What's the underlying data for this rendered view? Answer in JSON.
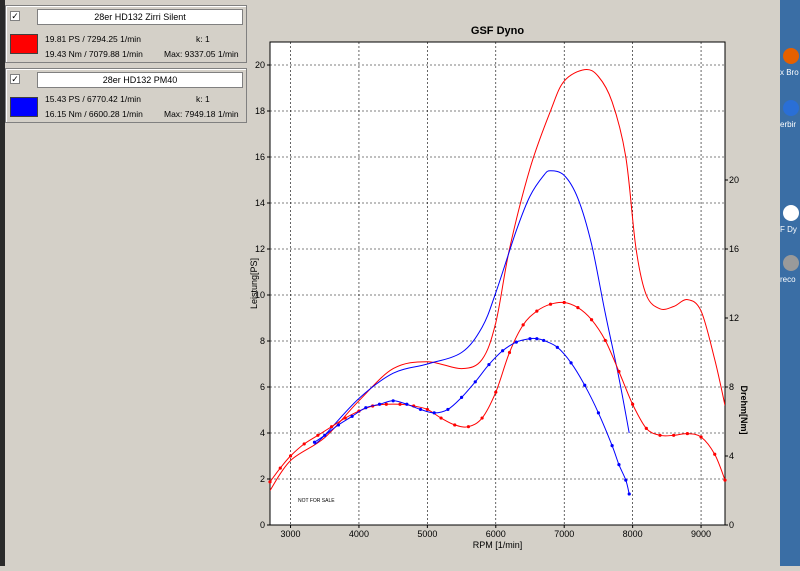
{
  "legend": [
    {
      "checked": "✓",
      "name": "28er HD132 Zirri Silent",
      "color": "#ff0000",
      "line1": "19.81 PS / 7294.25 1/min",
      "k": "k: 1",
      "line2": "19.43 Nm / 7079.88 1/min",
      "max": "Max: 9337.05 1/min"
    },
    {
      "checked": "✓",
      "name": "28er HD132 PM40",
      "color": "#0000ff",
      "line1": "15.43 PS / 6770.42 1/min",
      "k": "k: 1",
      "line2": "16.15 Nm / 6600.28 1/min",
      "max": "Max: 7949.18 1/min"
    }
  ],
  "desktop_icons": [
    {
      "name": "firefox-icon",
      "label": "x Bro",
      "color": "#e66000"
    },
    {
      "name": "thunderbird-icon",
      "label": "erbir",
      "color": "#2a6fd6"
    },
    {
      "name": "dyno-app-icon",
      "label": "F Dy",
      "color": "#ffffff"
    },
    {
      "name": "speaker-icon",
      "label": "reco",
      "color": "#9a9a9a"
    }
  ],
  "chart_data": {
    "type": "line",
    "title": "GSF Dyno",
    "xlabel": "RPM [1/min]",
    "ylabel": "Leistung[PS]",
    "y2label": "Drehm[Nm]",
    "watermark": "NOT FOR SALE",
    "xlim": [
      2700,
      9350
    ],
    "ylim": [
      0,
      21
    ],
    "y2lim": [
      0,
      28
    ],
    "xticks": [
      3000,
      4000,
      5000,
      6000,
      7000,
      8000,
      9000
    ],
    "yticks": [
      0,
      2,
      4,
      6,
      8,
      10,
      12,
      14,
      16,
      18,
      20
    ],
    "y2ticks": [
      0,
      4,
      8,
      12,
      16,
      20
    ],
    "grid": true,
    "series": [
      {
        "name": "28er HD132 Zirri Silent",
        "quantity": "Leistung [PS]",
        "color": "#ff0000",
        "x": [
          2700,
          3000,
          3500,
          4000,
          4500,
          5000,
          5500,
          5800,
          6000,
          6200,
          6500,
          6800,
          7000,
          7300,
          7500,
          7700,
          7900,
          8050,
          8200,
          8400,
          8600,
          8800,
          9000,
          9200,
          9350
        ],
        "y": [
          1.5,
          2.8,
          3.8,
          5.4,
          6.8,
          7.1,
          6.8,
          7.2,
          8.8,
          12.0,
          15.5,
          18.0,
          19.3,
          19.8,
          19.5,
          18.4,
          16.0,
          12.0,
          10.0,
          9.4,
          9.5,
          9.8,
          9.3,
          7.2,
          5.2
        ]
      },
      {
        "name": "28er HD132 PM40",
        "quantity": "Leistung [PS]",
        "color": "#0000ff",
        "x": [
          3350,
          3500,
          4000,
          4500,
          5000,
          5500,
          5800,
          6000,
          6300,
          6500,
          6700,
          6800,
          7000,
          7200,
          7400,
          7600,
          7800,
          7950
        ],
        "y": [
          3.5,
          3.9,
          5.5,
          6.6,
          7.0,
          7.5,
          8.6,
          10.1,
          12.8,
          14.3,
          15.2,
          15.4,
          15.2,
          14.2,
          12.2,
          9.2,
          6.4,
          4.0
        ]
      },
      {
        "name": "28er HD132 Zirri Silent",
        "quantity": "Drehm [Nm]",
        "color": "#ff0000",
        "markers": true,
        "x": [
          2700,
          2850,
          3000,
          3200,
          3400,
          3600,
          3800,
          4000,
          4200,
          4400,
          4600,
          4800,
          5000,
          5200,
          5400,
          5600,
          5800,
          6000,
          6200,
          6400,
          6600,
          6800,
          7000,
          7200,
          7400,
          7600,
          7800,
          8000,
          8200,
          8400,
          8600,
          8800,
          9000,
          9200,
          9350
        ],
        "y": [
          2.5,
          3.3,
          4.0,
          4.7,
          5.2,
          5.7,
          6.2,
          6.6,
          6.9,
          7.0,
          7.0,
          6.9,
          6.7,
          6.2,
          5.8,
          5.7,
          6.2,
          7.7,
          10.0,
          11.6,
          12.4,
          12.8,
          12.9,
          12.6,
          11.9,
          10.7,
          8.9,
          7.0,
          5.6,
          5.2,
          5.2,
          5.3,
          5.1,
          4.1,
          2.6
        ]
      },
      {
        "name": "28er HD132 PM40",
        "quantity": "Drehm [Nm]",
        "color": "#0000ff",
        "markers": true,
        "x": [
          3350,
          3500,
          3700,
          3900,
          4100,
          4300,
          4500,
          4700,
          4900,
          5100,
          5300,
          5500,
          5700,
          5900,
          6100,
          6300,
          6500,
          6600,
          6700,
          6900,
          7100,
          7300,
          7500,
          7700,
          7800,
          7900,
          7950
        ],
        "y": [
          4.8,
          5.2,
          5.8,
          6.3,
          6.8,
          7.0,
          7.2,
          7.0,
          6.7,
          6.5,
          6.7,
          7.4,
          8.3,
          9.3,
          10.1,
          10.6,
          10.8,
          10.8,
          10.7,
          10.3,
          9.4,
          8.1,
          6.5,
          4.6,
          3.5,
          2.6,
          1.8
        ]
      }
    ]
  }
}
